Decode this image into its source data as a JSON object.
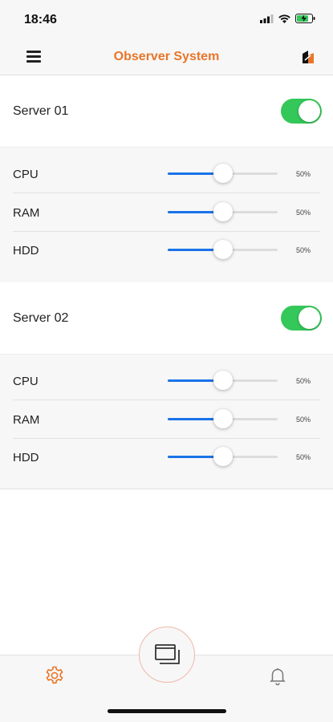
{
  "status_bar": {
    "time": "18:46"
  },
  "header": {
    "title": "Observer System"
  },
  "servers": [
    {
      "name": "Server 01",
      "enabled": true,
      "metrics": [
        {
          "label": "CPU",
          "value": "50%",
          "level": 0.5
        },
        {
          "label": "RAM",
          "value": "50%",
          "level": 0.5
        },
        {
          "label": "HDD",
          "value": "50%",
          "level": 0.5
        }
      ]
    },
    {
      "name": "Server 02",
      "enabled": true,
      "metrics": [
        {
          "label": "CPU",
          "value": "50%",
          "level": 0.5
        },
        {
          "label": "RAM",
          "value": "50%",
          "level": 0.5
        },
        {
          "label": "HDD",
          "value": "50%",
          "level": 0.5
        }
      ]
    }
  ],
  "tab_bar": {
    "active_tab": "settings",
    "icons": [
      "gear-icon",
      "windows-icon",
      "bell-icon"
    ]
  },
  "colors": {
    "accent": "#e8762a",
    "slider": "#1a73e8",
    "toggle_on": "#34c759"
  }
}
